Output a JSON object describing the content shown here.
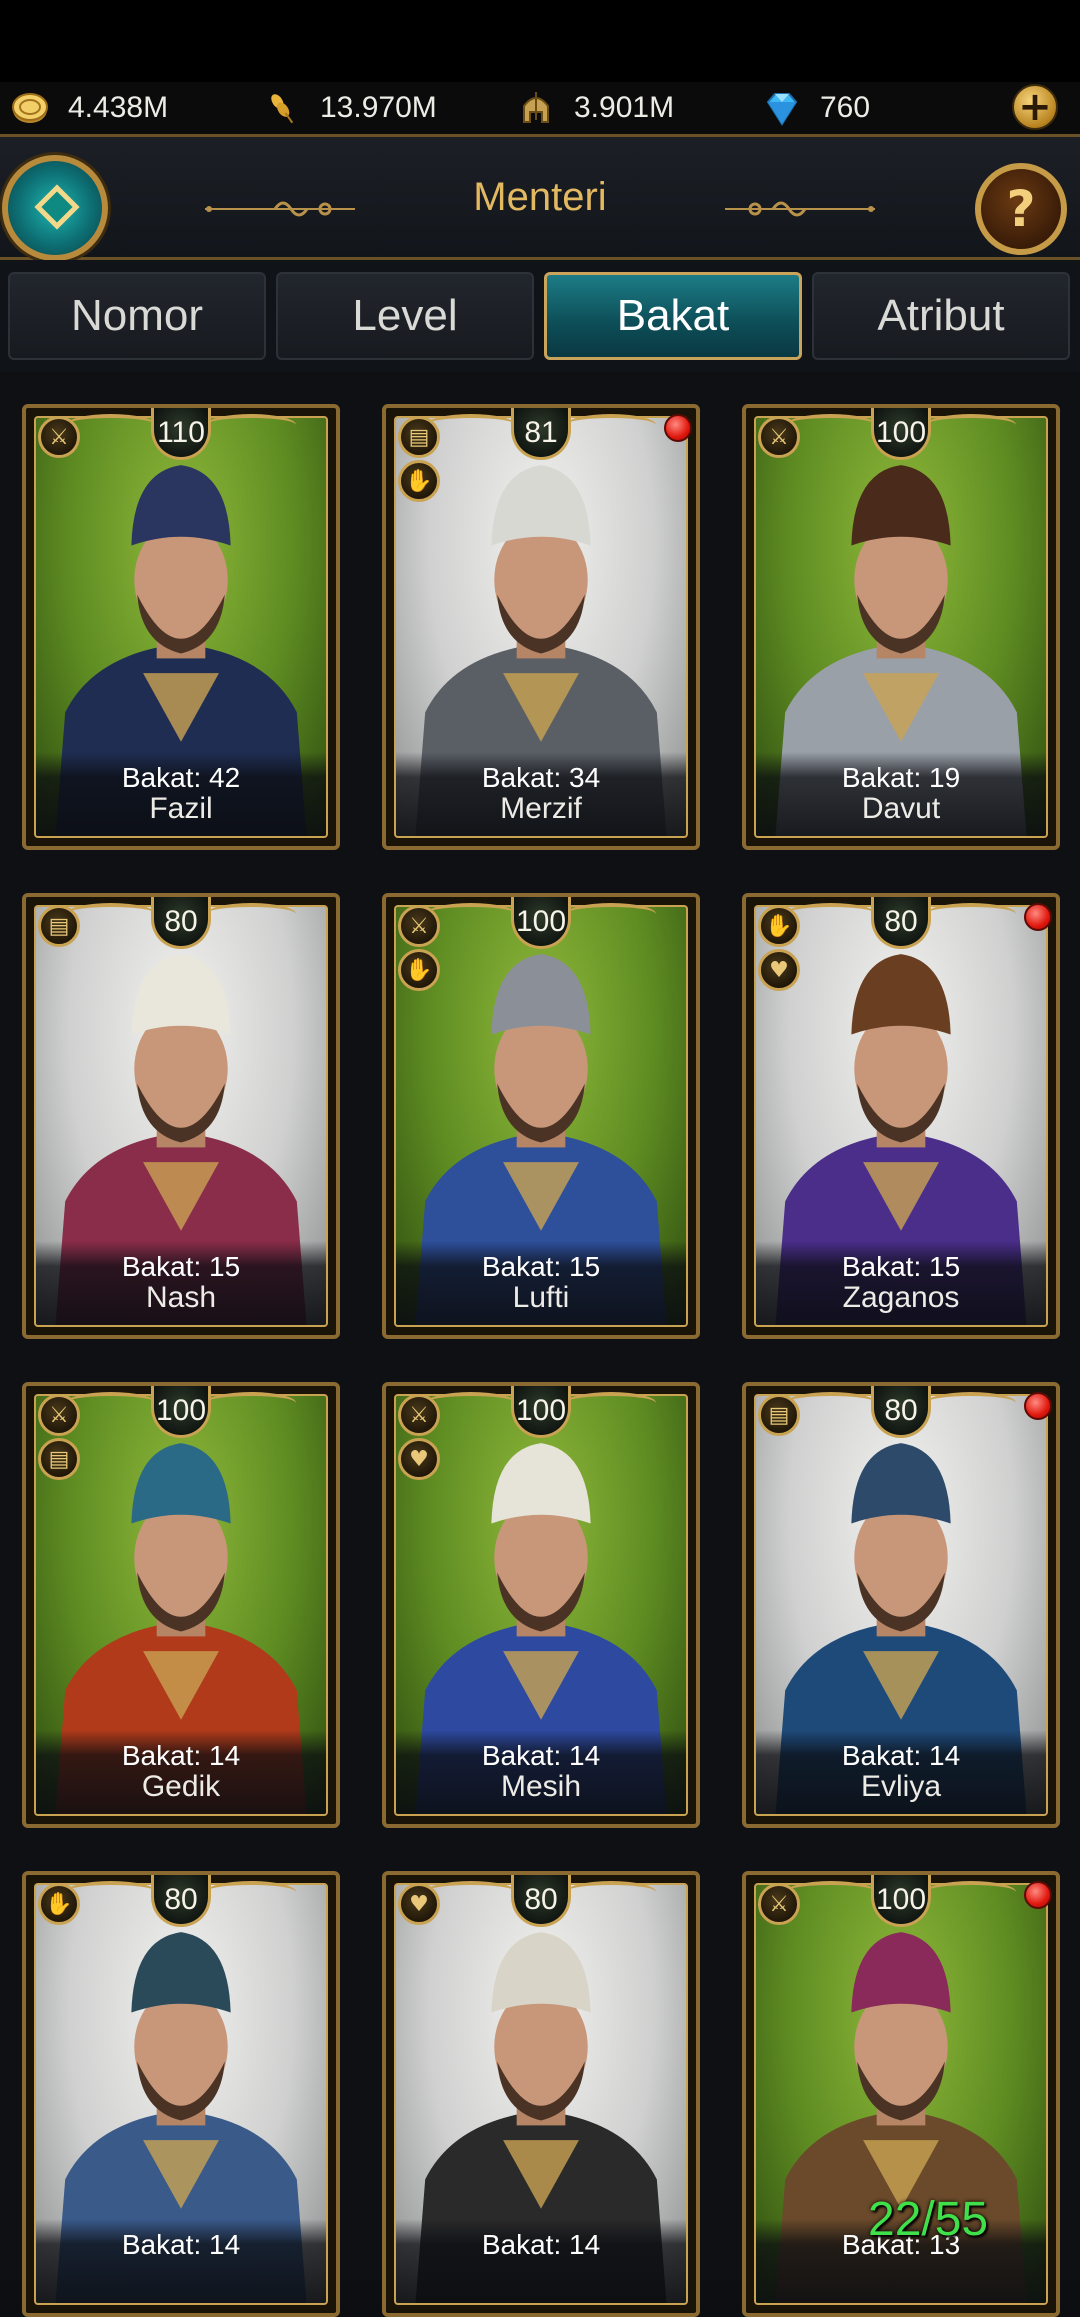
{
  "resources": [
    {
      "icon": "gold-coin-icon",
      "value": "4.438M"
    },
    {
      "icon": "grain-icon",
      "value": "13.970M"
    },
    {
      "icon": "soldier-helmet-icon",
      "value": "3.901M"
    },
    {
      "icon": "diamond-icon",
      "value": "760"
    }
  ],
  "header": {
    "title": "Menteri"
  },
  "tabs": [
    {
      "label": "Nomor",
      "active": false
    },
    {
      "label": "Level",
      "active": false
    },
    {
      "label": "Bakat",
      "active": true
    },
    {
      "label": "Atribut",
      "active": false
    }
  ],
  "ministers": [
    {
      "name": "Fazil",
      "bakat": "Bakat: 42",
      "level": "110",
      "bg": "green",
      "skills": [
        "sword-icon"
      ],
      "alert": false
    },
    {
      "name": "Merzif",
      "bakat": "Bakat: 34",
      "level": "81",
      "bg": "silver",
      "skills": [
        "book-icon",
        "handshake-icon"
      ],
      "alert": true
    },
    {
      "name": "Davut",
      "bakat": "Bakat: 19",
      "level": "100",
      "bg": "green",
      "skills": [
        "sword-icon"
      ],
      "alert": false
    },
    {
      "name": "Nash",
      "bakat": "Bakat: 15",
      "level": "80",
      "bg": "silver",
      "skills": [
        "book-icon"
      ],
      "alert": false
    },
    {
      "name": "Lufti",
      "bakat": "Bakat: 15",
      "level": "100",
      "bg": "green",
      "skills": [
        "sword-icon",
        "handshake-icon"
      ],
      "alert": false
    },
    {
      "name": "Zaganos",
      "bakat": "Bakat: 15",
      "level": "80",
      "bg": "silver",
      "skills": [
        "handshake-icon",
        "heart-icon"
      ],
      "alert": true
    },
    {
      "name": "Gedik",
      "bakat": "Bakat: 14",
      "level": "100",
      "bg": "green",
      "skills": [
        "sword-icon",
        "book-icon"
      ],
      "alert": false
    },
    {
      "name": "Mesih",
      "bakat": "Bakat: 14",
      "level": "100",
      "bg": "green",
      "skills": [
        "sword-icon",
        "heart-icon"
      ],
      "alert": false
    },
    {
      "name": "Evliya",
      "bakat": "Bakat: 14",
      "level": "80",
      "bg": "silver",
      "skills": [
        "book-icon"
      ],
      "alert": true
    },
    {
      "name": "",
      "bakat": "Bakat: 14",
      "level": "80",
      "bg": "silver",
      "skills": [
        "handshake-icon"
      ],
      "alert": false
    },
    {
      "name": "",
      "bakat": "Bakat: 14",
      "level": "80",
      "bg": "silver",
      "skills": [
        "heart-icon"
      ],
      "alert": false
    },
    {
      "name": "",
      "bakat": "Bakat: 13",
      "level": "100",
      "bg": "green",
      "skills": [
        "sword-icon"
      ],
      "alert": true
    }
  ],
  "counter": "22/55",
  "colors": {
    "accent_gold": "#c9a252",
    "title_gold": "#e2b861",
    "tab_active": "#0d4d57",
    "counter_green": "#3fe04a"
  }
}
